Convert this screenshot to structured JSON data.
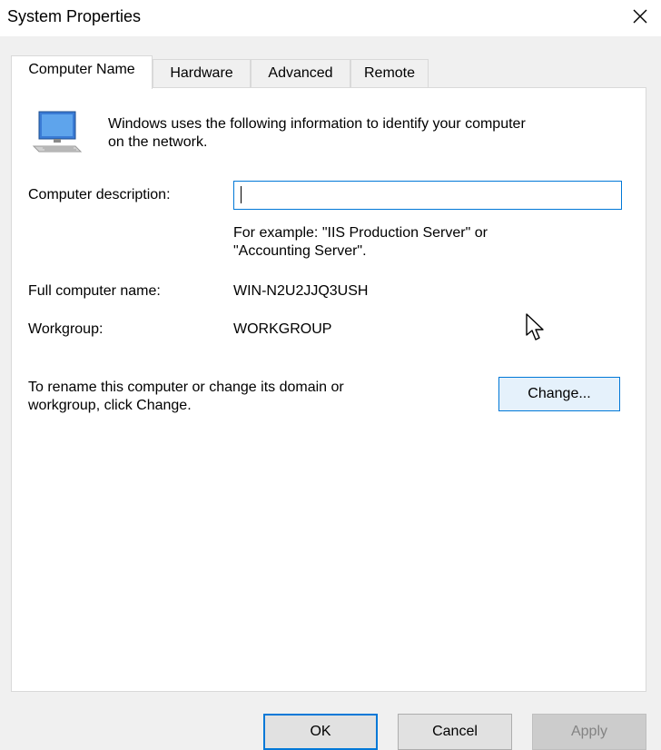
{
  "window": {
    "title": "System Properties",
    "close_icon": "close-icon"
  },
  "tabs": [
    {
      "label": "Computer Name",
      "active": true
    },
    {
      "label": "Hardware",
      "active": false
    },
    {
      "label": "Advanced",
      "active": false
    },
    {
      "label": "Remote",
      "active": false
    }
  ],
  "computer_name_tab": {
    "icon": "computer-monitor-icon",
    "intro_line1": "Windows uses the following information to identify your computer",
    "intro_line2": "on the network.",
    "description_label": "Computer description:",
    "description_value": "",
    "example_line1": "For example: \"IIS Production Server\" or",
    "example_line2": "\"Accounting Server\".",
    "full_name_label": "Full computer name:",
    "full_name_value": "WIN-N2U2JJQ3USH",
    "workgroup_label": "Workgroup:",
    "workgroup_value": "WORKGROUP",
    "rename_line1": "To rename this computer or change its domain or",
    "rename_line2": "workgroup, click Change.",
    "change_button": "Change..."
  },
  "footer": {
    "ok": "OK",
    "cancel": "Cancel",
    "apply": "Apply"
  },
  "colors": {
    "accent": "#0078d7",
    "window_bg": "#f0f0f0",
    "panel_bg": "#ffffff",
    "disabled_text": "#838383"
  }
}
